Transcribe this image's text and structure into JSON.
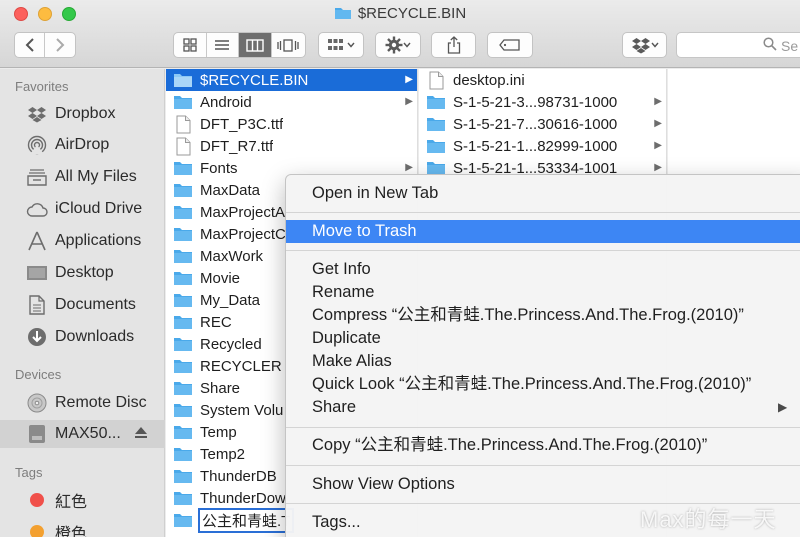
{
  "window": {
    "title": "$RECYCLE.BIN"
  },
  "toolbar": {
    "search_placeholder": "Se"
  },
  "sidebar": {
    "favorites_header": "Favorites",
    "favorites": [
      {
        "label": "Dropbox",
        "icon": "dropbox-icon"
      },
      {
        "label": "AirDrop",
        "icon": "airdrop-icon"
      },
      {
        "label": "All My Files",
        "icon": "all-files-icon"
      },
      {
        "label": "iCloud Drive",
        "icon": "cloud-icon"
      },
      {
        "label": "Applications",
        "icon": "applications-icon"
      },
      {
        "label": "Desktop",
        "icon": "desktop-icon"
      },
      {
        "label": "Documents",
        "icon": "document-icon"
      },
      {
        "label": "Downloads",
        "icon": "download-icon"
      }
    ],
    "devices_header": "Devices",
    "devices": [
      {
        "label": "Remote Disc",
        "icon": "disc-icon"
      },
      {
        "label": "MAX50...",
        "icon": "drive-icon"
      }
    ],
    "tags_header": "Tags",
    "tags": [
      {
        "label": "紅色",
        "color": "#f0504a"
      },
      {
        "label": "橙色",
        "color": "#f3a030"
      }
    ]
  },
  "column1": [
    {
      "name": "$RECYCLE.BIN",
      "type": "folder",
      "arrow": true,
      "selected": true
    },
    {
      "name": "Android",
      "type": "folder",
      "arrow": true
    },
    {
      "name": "DFT_P3C.ttf",
      "type": "file"
    },
    {
      "name": "DFT_R7.ttf",
      "type": "file"
    },
    {
      "name": "Fonts",
      "type": "folder",
      "arrow": true
    },
    {
      "name": "MaxData",
      "type": "folder"
    },
    {
      "name": "MaxProjectA",
      "type": "folder"
    },
    {
      "name": "MaxProjectC",
      "type": "folder"
    },
    {
      "name": "MaxWork",
      "type": "folder"
    },
    {
      "name": "Movie",
      "type": "folder"
    },
    {
      "name": "My_Data",
      "type": "folder"
    },
    {
      "name": "REC",
      "type": "folder"
    },
    {
      "name": "Recycled",
      "type": "folder"
    },
    {
      "name": "RECYCLER",
      "type": "folder"
    },
    {
      "name": "Share",
      "type": "folder"
    },
    {
      "name": "System Volu",
      "type": "folder"
    },
    {
      "name": "Temp",
      "type": "folder"
    },
    {
      "name": "Temp2",
      "type": "folder"
    },
    {
      "name": "ThunderDB",
      "type": "folder"
    },
    {
      "name": "ThunderDow",
      "type": "folder"
    },
    {
      "name": "公主和青蛙.T",
      "type": "folder",
      "outlined": true
    }
  ],
  "column2": [
    {
      "name": "desktop.ini",
      "type": "file"
    },
    {
      "name": "S-1-5-21-3...98731-1000",
      "type": "folder",
      "arrow": true
    },
    {
      "name": "S-1-5-21-7...30616-1000",
      "type": "folder",
      "arrow": true
    },
    {
      "name": "S-1-5-21-1...82999-1000",
      "type": "folder",
      "arrow": true
    },
    {
      "name": "S-1-5-21-1...53334-1001",
      "type": "folder",
      "arrow": true
    }
  ],
  "context_menu": {
    "open_new_tab": "Open in New Tab",
    "move_to_trash": "Move to Trash",
    "get_info": "Get Info",
    "rename": "Rename",
    "compress": "Compress “公主和青蛙.The.Princess.And.The.Frog.(2010)”",
    "duplicate": "Duplicate",
    "make_alias": "Make Alias",
    "quick_look": "Quick Look “公主和青蛙.The.Princess.And.The.Frog.(2010)”",
    "share": "Share",
    "copy": "Copy “公主和青蛙.The.Princess.And.The.Frog.(2010)”",
    "show_view_options": "Show View Options",
    "tags": "Tags..."
  },
  "watermark": "Max的每一天",
  "colors": {
    "selection": "#1a6cd8",
    "menu_highlight": "#3d86f4",
    "folder": "#4aa9ea"
  }
}
